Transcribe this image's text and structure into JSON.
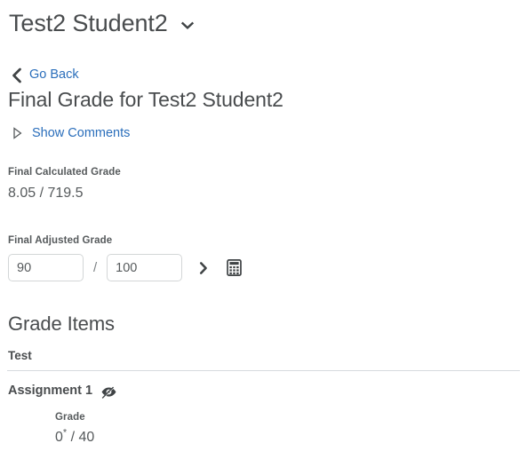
{
  "header": {
    "title": "Test2 Student2",
    "dropdown_icon": "chevron-down-icon"
  },
  "navigation": {
    "go_back_label": "Go Back",
    "go_back_icon": "chevron-left-icon"
  },
  "main": {
    "heading": "Final Grade for Test2 Student2",
    "comments_toggle_label": "Show Comments",
    "comments_toggle_icon": "triangle-right-icon",
    "final_calculated": {
      "label": "Final Calculated Grade",
      "value": "8.05 / 719.5"
    },
    "final_adjusted": {
      "label": "Final Adjusted Grade",
      "numerator": "90",
      "numerator_placeholder": "",
      "denominator": "100",
      "denominator_placeholder": "",
      "separator": "/",
      "expand_icon": "chevron-right-icon",
      "calculator_icon": "calculator-icon"
    },
    "grade_items": {
      "heading": "Grade Items",
      "categories": [
        {
          "name": "Test",
          "items": [
            {
              "name": "Assignment 1",
              "status_icon": "eye-slash-icon",
              "grade_label": "Grade",
              "grade_value": "0",
              "grade_value_marker": "*",
              "grade_out_of": " / 40"
            }
          ]
        }
      ]
    }
  },
  "colors": {
    "link": "#2a6ebb",
    "text": "#565a5c",
    "heading": "#494c4e",
    "border": "#d3d6d7",
    "divider": "#d6dade",
    "icon": "#3f4345"
  }
}
